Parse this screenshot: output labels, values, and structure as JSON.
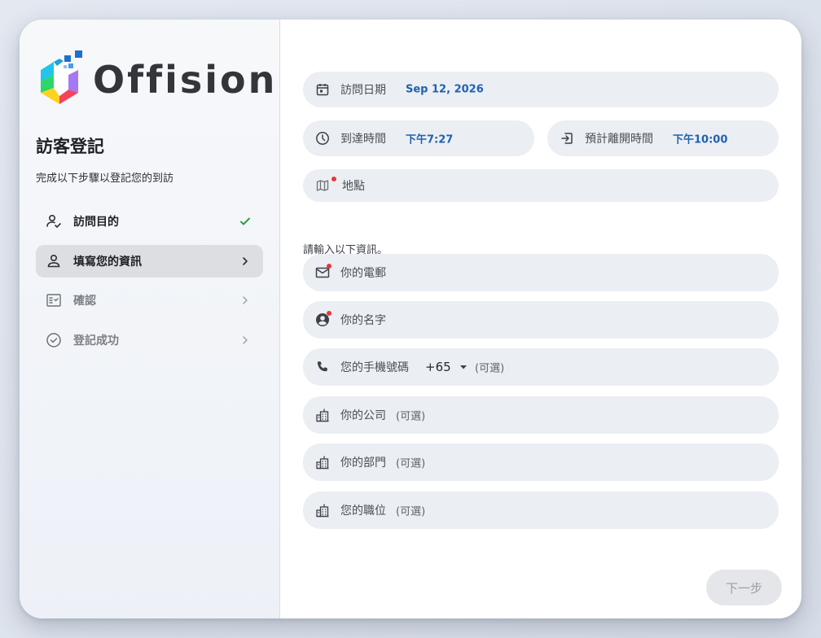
{
  "brand": {
    "name": "Offision"
  },
  "sidebar": {
    "title": "訪客登記",
    "subtitle": "完成以下步驟以登記您的到訪",
    "steps": [
      {
        "label": "訪問目的",
        "state": "done"
      },
      {
        "label": "填寫您的資訊",
        "state": "active"
      },
      {
        "label": "確認",
        "state": "pending"
      },
      {
        "label": "登記成功",
        "state": "pending"
      }
    ]
  },
  "visit": {
    "date_label": "訪問日期",
    "date_value": "Sep 12, 2026",
    "arrival_label": "到達時間",
    "arrival_value": "下午7:27",
    "departure_label": "預計離開時間",
    "departure_value": "下午10:00",
    "location_label": "地點"
  },
  "form": {
    "hint": "請輸入以下資訊。",
    "email_placeholder": "你的電郵",
    "name_placeholder": "你的名字",
    "phone_placeholder": "您的手機號碼",
    "country_code": "+65",
    "optional": "(可選)",
    "company_placeholder": "你的公司",
    "department_placeholder": "你的部門",
    "title_placeholder": "您的職位"
  },
  "actions": {
    "next_label": "下一步"
  },
  "colors": {
    "accent": "#1f62b0",
    "success": "#2e9e4f",
    "required": "#e53935"
  }
}
